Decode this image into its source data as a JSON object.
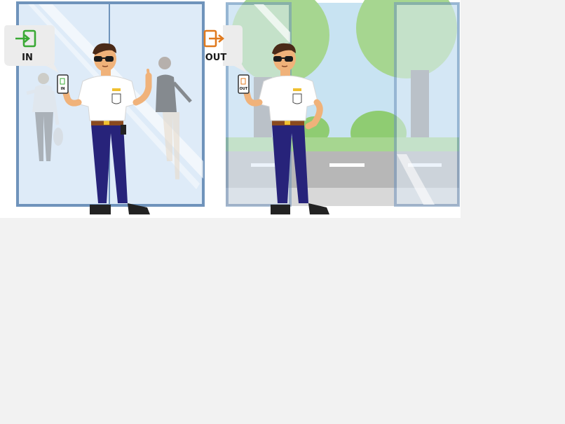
{
  "scenes": [
    {
      "label": "IN",
      "icon": "sign-in-icon",
      "accent": "#3aa935"
    },
    {
      "label": "OUT",
      "icon": "sign-out-icon",
      "accent": "#e07a1f"
    }
  ],
  "colors": {
    "frame": "#6f93bb",
    "glass": "#deebf8",
    "sky": "#c8e3f2",
    "tree": "#a6d690",
    "road": "#b7b7b7",
    "uniform_pants": "#27237a",
    "shirt": "#ffffff",
    "skin": "#f0b27a",
    "hair": "#4a2a18"
  }
}
